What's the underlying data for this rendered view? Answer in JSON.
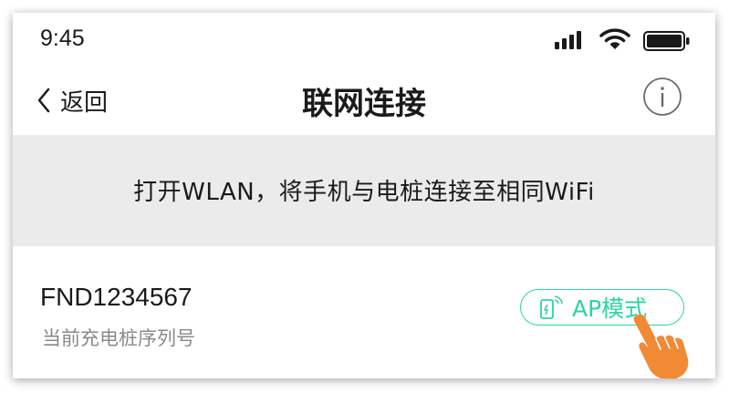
{
  "status_bar": {
    "time": "9:45",
    "icons": [
      "signal-icon",
      "wifi-icon",
      "battery-icon"
    ]
  },
  "nav": {
    "back_label": "返回",
    "title": "联网连接",
    "info_icon": "info-icon"
  },
  "banner": {
    "text": "打开WLAN，将手机与电桩连接至相同WiFi"
  },
  "device": {
    "serial": "FND1234567",
    "caption": "当前充电桩序列号",
    "ap_button_label": "AP模式",
    "ap_icon": "charger-wifi-icon"
  },
  "colors": {
    "accent": "#2ed3a6",
    "banner_bg": "#ebebeb",
    "hand": "#f08a35",
    "text_primary": "#1a1a1a",
    "text_secondary": "#8a8a8a"
  }
}
